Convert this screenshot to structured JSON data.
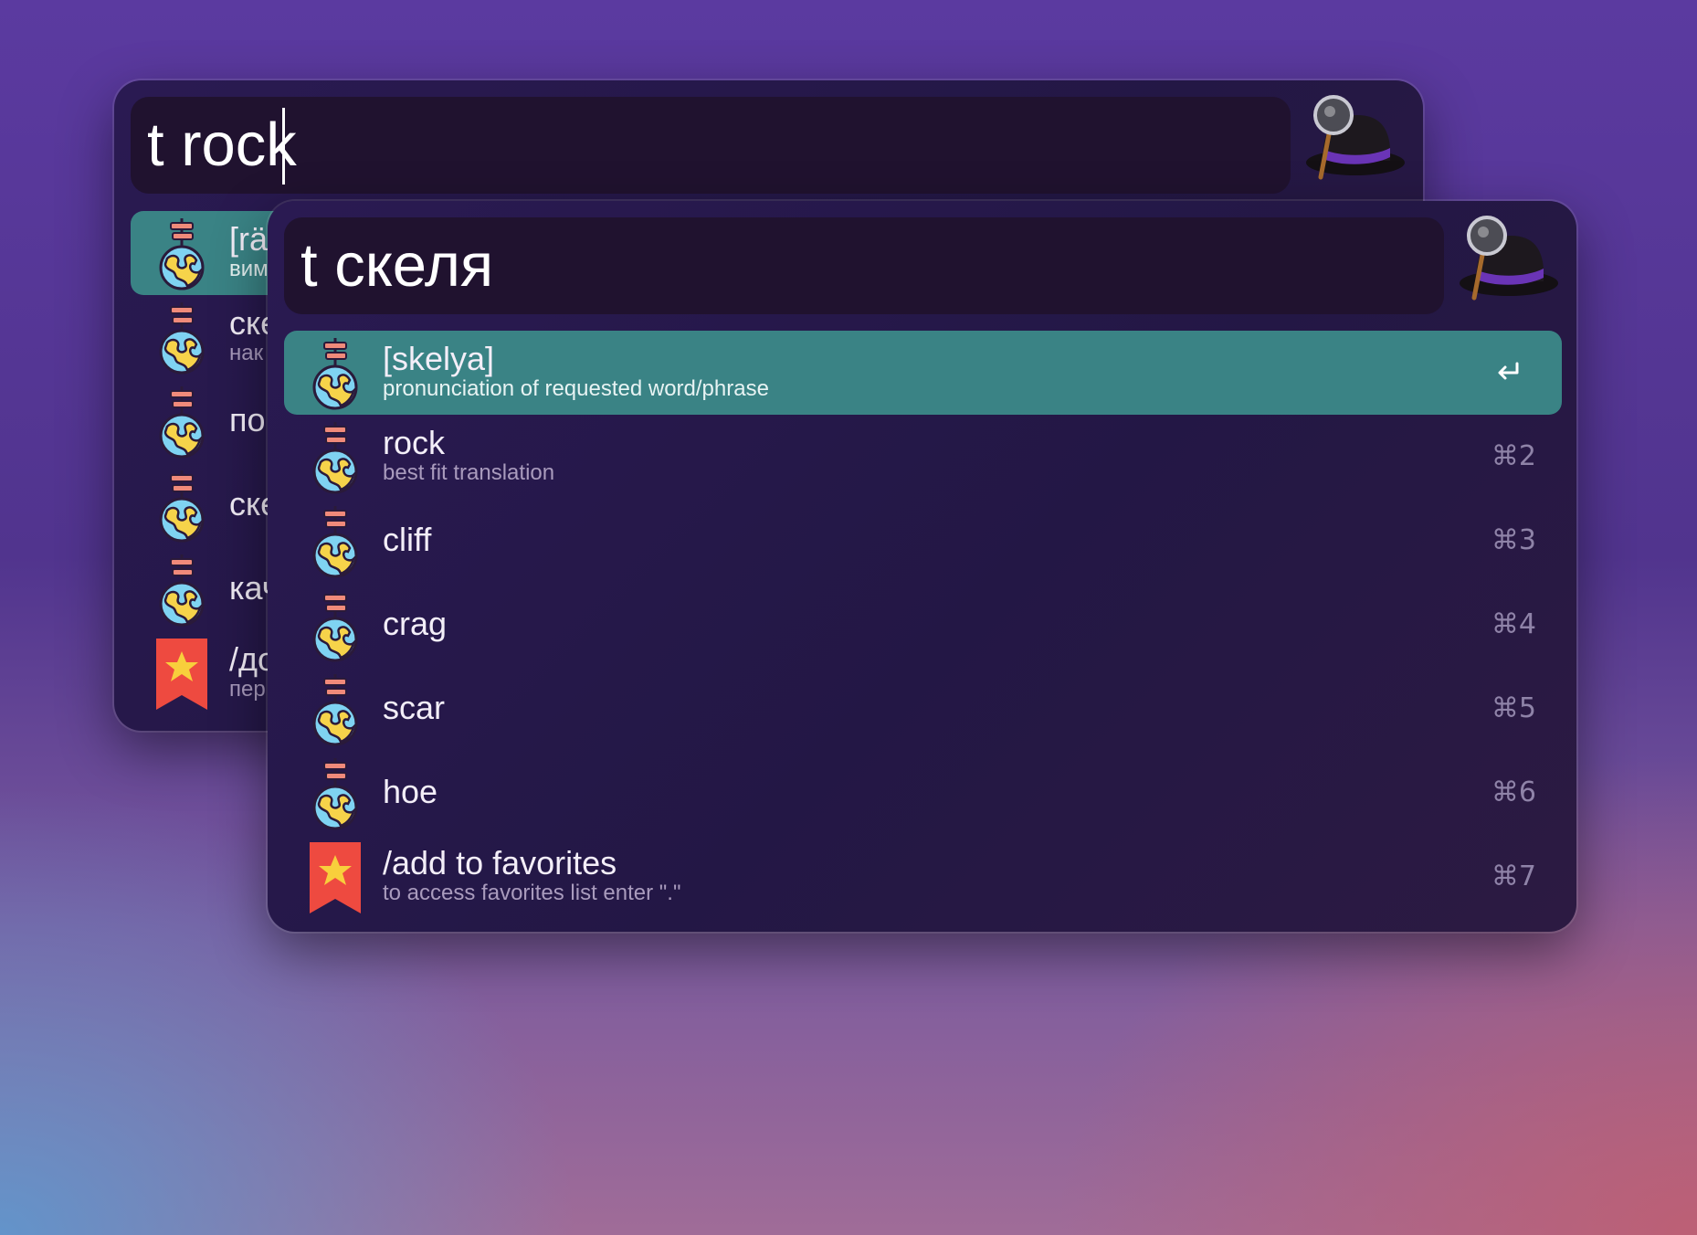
{
  "back_window": {
    "query": "t rock",
    "results": [
      {
        "title": "[rä",
        "subtitle": "вим",
        "icon": "globe-signpost-icon",
        "selected": true
      },
      {
        "title": "ске",
        "subtitle": "нак",
        "icon": "globe-signpost-icon"
      },
      {
        "title": "по",
        "subtitle": "",
        "icon": "globe-signpost-icon"
      },
      {
        "title": "ске",
        "subtitle": "",
        "icon": "globe-signpost-icon"
      },
      {
        "title": "кач",
        "subtitle": "",
        "icon": "globe-signpost-icon"
      },
      {
        "title": "/до",
        "subtitle": "пер",
        "icon": "bookmark-star-icon"
      }
    ]
  },
  "front_window": {
    "query": "t скеля",
    "results": [
      {
        "title": "[skelya]",
        "subtitle": "pronunciation of requested word/phrase",
        "shortcut": "↩",
        "icon": "globe-signpost-icon",
        "selected": true
      },
      {
        "title": "rock",
        "subtitle": "best fit translation",
        "shortcut": "⌘2",
        "icon": "globe-signpost-icon"
      },
      {
        "title": "cliff",
        "subtitle": "",
        "shortcut": "⌘3",
        "icon": "globe-signpost-icon"
      },
      {
        "title": "crag",
        "subtitle": "",
        "shortcut": "⌘4",
        "icon": "globe-signpost-icon"
      },
      {
        "title": "scar",
        "subtitle": "",
        "shortcut": "⌘5",
        "icon": "globe-signpost-icon"
      },
      {
        "title": "hoe",
        "subtitle": "",
        "shortcut": "⌘6",
        "icon": "globe-signpost-icon"
      },
      {
        "title": "/add to favorites",
        "subtitle": "to access favorites list enter \".\"",
        "shortcut": "⌘7",
        "icon": "bookmark-star-icon"
      }
    ]
  },
  "app_icon": "alfred-hat-icon",
  "colors": {
    "selection": "#3a8385",
    "window_bg": "#261848",
    "search_bg": "#20122f",
    "subtitle": "#a99bbd",
    "shortcut": "#8f83a8"
  }
}
